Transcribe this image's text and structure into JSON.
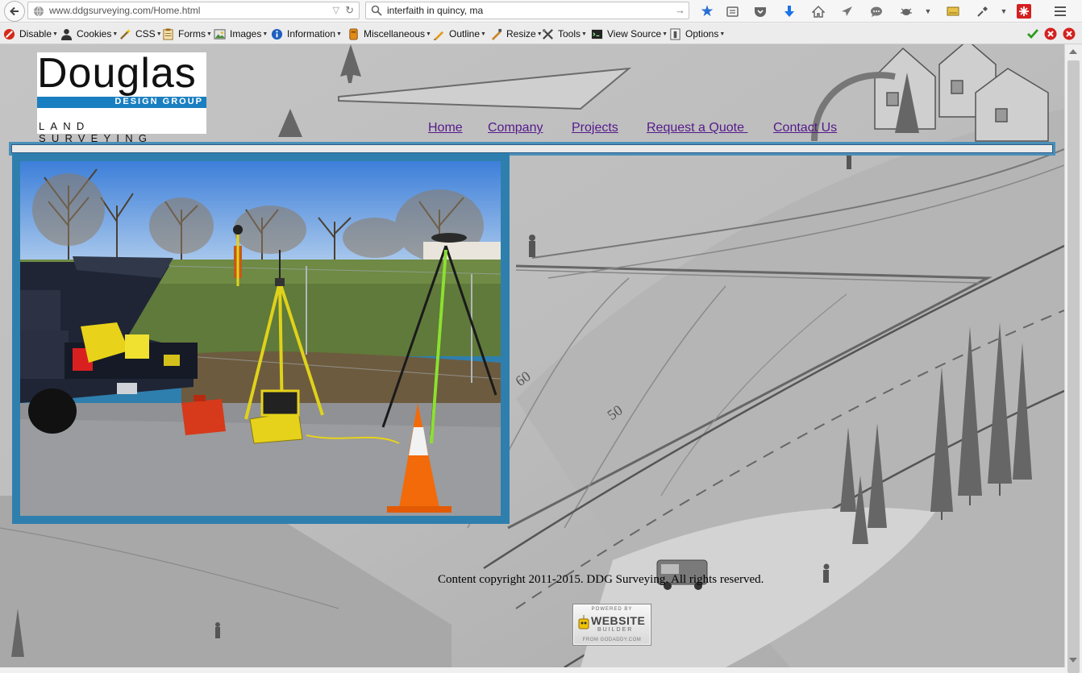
{
  "browser": {
    "url": "www.ddgsurveying.com/Home.html",
    "search_query": "interfaith in quincy, ma",
    "toolbar_icons": [
      "bookmark-star-icon",
      "reading-list-icon",
      "pocket-icon",
      "download-icon",
      "home-icon",
      "send-icon",
      "chat-icon",
      "bug-icon",
      "menu-caret-icon",
      "note-icon",
      "dropper-icon",
      "menu-caret-icon",
      "addon-red-icon",
      "hamburger-menu-icon"
    ]
  },
  "devtoolbar": {
    "items": [
      {
        "label": "Disable",
        "icon": "disable-icon"
      },
      {
        "label": "Cookies",
        "icon": "cookies-icon"
      },
      {
        "label": "CSS",
        "icon": "css-icon"
      },
      {
        "label": "Forms",
        "icon": "forms-icon"
      },
      {
        "label": "Images",
        "icon": "images-icon"
      },
      {
        "label": "Information",
        "icon": "information-icon"
      },
      {
        "label": "Miscellaneous",
        "icon": "miscellaneous-icon"
      },
      {
        "label": "Outline",
        "icon": "outline-icon"
      },
      {
        "label": "Resize",
        "icon": "resize-icon"
      },
      {
        "label": "Tools",
        "icon": "tools-icon"
      },
      {
        "label": "View Source",
        "icon": "view-source-icon"
      },
      {
        "label": "Options",
        "icon": "options-icon"
      }
    ]
  },
  "site": {
    "logo": {
      "word": "Douglas",
      "bar_text": "DESIGN GROUP",
      "subtitle": "LAND SURVEYING"
    },
    "nav": [
      "Home",
      "Company",
      "Projects",
      "Request a Quote ",
      "Contact Us"
    ],
    "map_labels": [
      "60",
      "50"
    ],
    "copyright": "Content copyright 2011-2015. DDG Surveying. All rights reserved.",
    "badge": {
      "powered_by": "POWERED BY",
      "website": "WEBSITE",
      "builder": "BUILDER",
      "from": "FROM GODADDY.COM"
    }
  },
  "colors": {
    "link": "#551a8b",
    "frame_blue": "#2f7fae",
    "logo_blue": "#1a7fc1"
  }
}
